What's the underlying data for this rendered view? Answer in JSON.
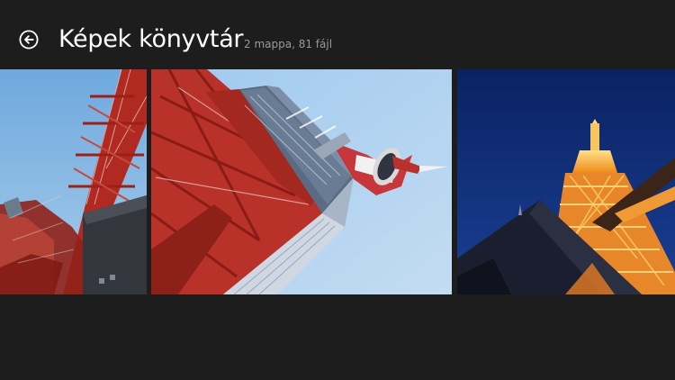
{
  "header": {
    "back_icon": "back-arrow-icon",
    "title": "Képek könyvtár",
    "subtitle": "2 mappa, 81 fájl"
  },
  "colors": {
    "background": "#1d1d1d",
    "title_text": "#ffffff",
    "subtitle_text": "#9a9a9a",
    "tower_red": "#c0392b",
    "sky_day": "#8fc3ec",
    "sky_night": "#0f2f7a",
    "tower_lit": "#f29a28"
  },
  "tiles": [
    {
      "subject": "tower-day-photo"
    },
    {
      "subject": "tower-observatory-photo"
    },
    {
      "subject": "tower-night-photo"
    }
  ]
}
